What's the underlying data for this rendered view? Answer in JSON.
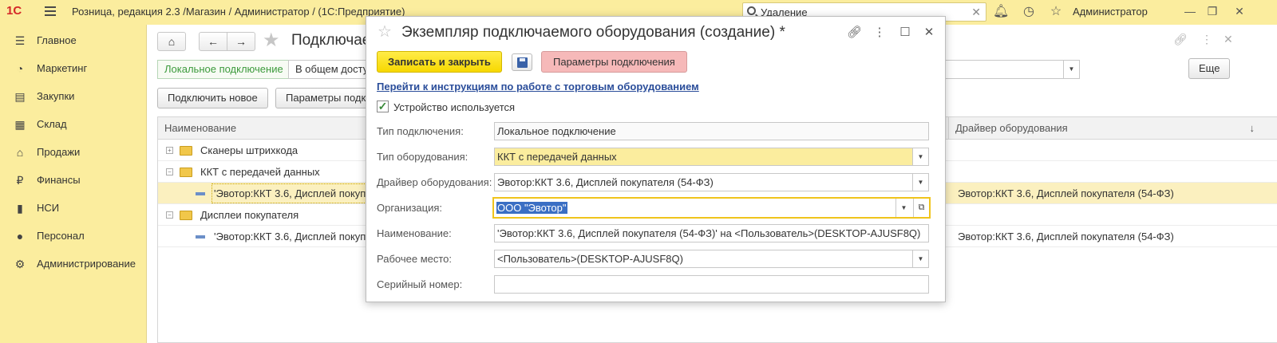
{
  "topbar": {
    "logo": "1С",
    "title": "Розница, редакция 2.3 /Магазин / Администратор /  (1С:Предприятие)",
    "search_value": "Удаление",
    "user": "Администратор"
  },
  "sidebar": {
    "items": [
      {
        "label": "Главное",
        "icon": "menu-lines-icon"
      },
      {
        "label": "Маркетинг",
        "icon": "pie-chart-icon"
      },
      {
        "label": "Закупки",
        "icon": "cart-icon"
      },
      {
        "label": "Склад",
        "icon": "grid-icon"
      },
      {
        "label": "Продажи",
        "icon": "basket-icon"
      },
      {
        "label": "Финансы",
        "icon": "ruble-icon"
      },
      {
        "label": "НСИ",
        "icon": "books-icon"
      },
      {
        "label": "Персонал",
        "icon": "person-icon"
      },
      {
        "label": "Администрирование",
        "icon": "gear-icon"
      }
    ]
  },
  "main": {
    "title": "Подключае",
    "tabs": [
      "Локальное подключение",
      "В общем досту"
    ],
    "btn_connect_new": "Подключить новое",
    "btn_params": "Параметры подк",
    "btn_more": "Еще",
    "table": {
      "col_name": "Наименование",
      "col_driver": "Драйвер оборудования",
      "rows": [
        {
          "level": 0,
          "type": "group",
          "expand": "+",
          "name": "Сканеры штрихкода",
          "driver": ""
        },
        {
          "level": 0,
          "type": "group",
          "expand": "−",
          "name": "ККТ с передачей данных",
          "driver": ""
        },
        {
          "level": 1,
          "type": "item",
          "name": "'Эвотор:ККТ 3.6, Дисплей покупате",
          "driver": "Эвотор:ККТ 3.6, Дисплей покупателя (54-ФЗ)",
          "selected": true
        },
        {
          "level": 0,
          "type": "group",
          "expand": "−",
          "name": "Дисплеи покупателя",
          "driver": ""
        },
        {
          "level": 1,
          "type": "item",
          "name": "'Эвотор:ККТ 3.6, Дисплей покупате",
          "driver": "Эвотор:ККТ 3.6, Дисплей покупателя (54-ФЗ)"
        }
      ]
    }
  },
  "dialog": {
    "title": "Экземпляр подключаемого оборудования (создание) *",
    "btn_save_close": "Записать и закрыть",
    "btn_conn_params": "Параметры подключения",
    "link_instructions": "Перейти к инструкциям по работе с торговым оборудованием",
    "checkbox_label": "Устройство используется",
    "checkbox_checked": true,
    "fields": {
      "connection_type": {
        "label": "Тип подключения:",
        "value": "Локальное подключение"
      },
      "equipment_type": {
        "label": "Тип оборудования:",
        "value": "ККТ с передачей данных"
      },
      "driver": {
        "label": "Драйвер оборудования:",
        "value": "Эвотор:ККТ 3.6, Дисплей покупателя (54-ФЗ)"
      },
      "organization": {
        "label": "Организация:",
        "value": "ООО \"Эвотор\""
      },
      "name": {
        "label": "Наименование:",
        "value": "'Эвотор:ККТ 3.6, Дисплей покупателя (54-ФЗ)' на <Пользователь>(DESKTOP-AJUSF8Q)"
      },
      "workplace": {
        "label": "Рабочее место:",
        "value": "<Пользователь>(DESKTOP-AJUSF8Q)"
      },
      "serial": {
        "label": "Серийный номер:",
        "value": ""
      }
    }
  },
  "colors": {
    "accent_yellow": "#fbed9e",
    "primary_button": "#f7d800",
    "danger_button": "#f6b9b9",
    "link": "#2a4d9a"
  }
}
